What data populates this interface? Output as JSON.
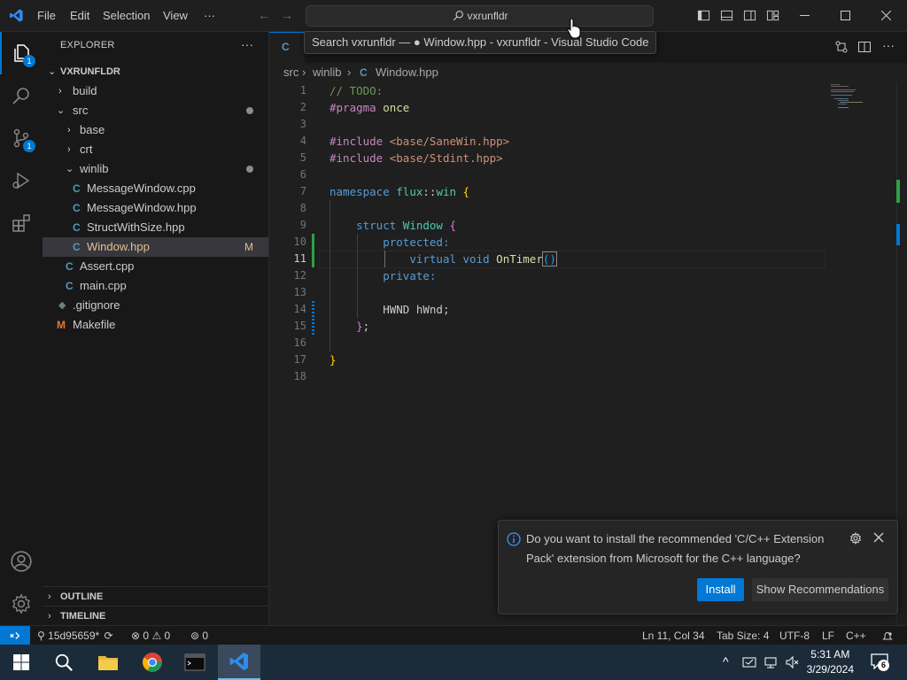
{
  "titlebar": {
    "menu": [
      "File",
      "Edit",
      "Selection",
      "View",
      "···"
    ],
    "search_text": "vxrunfldr"
  },
  "tooltip": "Search vxrunfldr — ● Window.hpp - vxrunfldr - Visual Studio Code",
  "activity": {
    "explorer_badge": "1",
    "scm_badge": "1"
  },
  "sidebar": {
    "title": "EXPLORER",
    "more": "···",
    "root": "VXRUNFLDR",
    "tree": [
      {
        "label": "build"
      },
      {
        "label": "src"
      },
      {
        "label": "base"
      },
      {
        "label": "crt"
      },
      {
        "label": "winlib"
      },
      {
        "label": "MessageWindow.cpp"
      },
      {
        "label": "MessageWindow.hpp"
      },
      {
        "label": "StructWithSize.hpp"
      },
      {
        "label": "Window.hpp",
        "badge": "M"
      },
      {
        "label": "Assert.cpp"
      },
      {
        "label": "main.cpp"
      },
      {
        "label": ".gitignore"
      },
      {
        "label": "Makefile"
      }
    ],
    "outline": "OUTLINE",
    "timeline": "TIMELINE"
  },
  "editor": {
    "breadcrumb": [
      "src",
      "winlib",
      "Window.hpp"
    ],
    "line_numbers": [
      "1",
      "2",
      "3",
      "4",
      "5",
      "6",
      "7",
      "8",
      "9",
      "10",
      "11",
      "12",
      "13",
      "14",
      "15",
      "16",
      "17",
      "18"
    ],
    "code": {
      "l1": "// TODO:",
      "l2a": "#pragma",
      "l2b": "once",
      "l4a": "#include",
      "l4b": "<base/SaneWin.hpp>",
      "l5a": "#include",
      "l5b": "<base/Stdint.hpp>",
      "l7a": "namespace",
      "l7b": "flux",
      "l7c": "::",
      "l7d": "win",
      "l7e": "{",
      "l9a": "struct",
      "l9b": "Window",
      "l9c": "{",
      "l10": "protected:",
      "l11a": "virtual",
      "l11b": "void",
      "l11c": "OnTimer",
      "l11d": "()",
      "l12": "private:",
      "l14a": "HWND",
      "l14b": "hWnd;",
      "l15a": "}",
      "l15b": ";",
      "l17": "}"
    }
  },
  "notification": {
    "message": "Do you want to install the recommended 'C/C++ Extension Pack' extension from Microsoft for the C++ language?",
    "install": "Install",
    "show": "Show Recommendations"
  },
  "statusbar": {
    "branch": "15d95659*",
    "errors": "0",
    "warnings": "0",
    "ports": "0",
    "position": "Ln 11, Col 34",
    "tabsize": "Tab Size: 4",
    "encoding": "UTF-8",
    "eol": "LF",
    "language": "C++"
  },
  "taskbar": {
    "time": "5:31 AM",
    "date": "3/29/2024",
    "notif_count": "6"
  },
  "colors": {
    "accent": "#0078d4",
    "modified": "#e2c08d",
    "added": "#2ea043"
  }
}
